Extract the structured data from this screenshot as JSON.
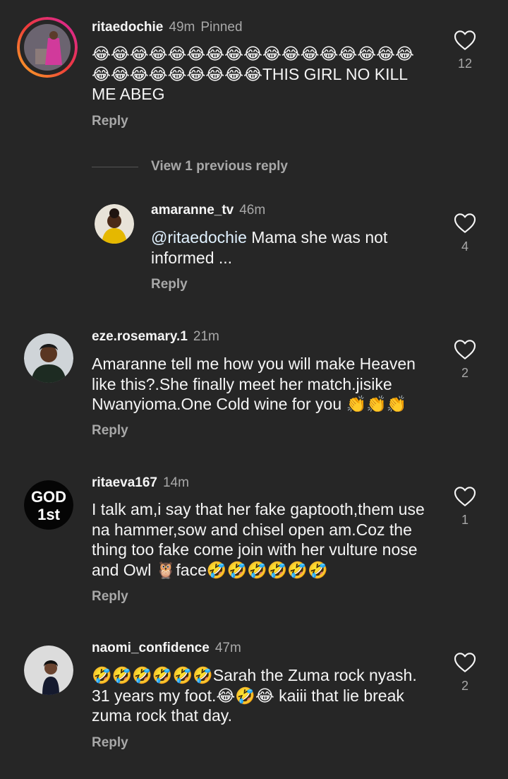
{
  "comments": [
    {
      "username": "ritaedochie",
      "time": "49m",
      "pinned": "Pinned",
      "text": "😂😂😂😂😂😂😂😂😂😂😂😂😂😂😂😂😂😂😂😂😂😂😂😂😂😂THIS GIRL NO KILL ME ABEG",
      "reply_label": "Reply",
      "likes": "12"
    },
    {
      "username": "eze.rosemary.1",
      "time": "21m",
      "text": "Amaranne tell me how you will make Heaven like this?.She finally meet her match.jisike Nwanyioma.One Cold wine for you 👏👏👏",
      "reply_label": "Reply",
      "likes": "2"
    },
    {
      "username": "ritaeva167",
      "time": "14m",
      "avatar_text_line1": "GOD",
      "avatar_text_line2": "1st",
      "text": "I talk am,i say that her fake gaptooth,them use na hammer,sow and chisel open am.Coz the thing too fake come join with her vulture nose and Owl 🦉face🤣🤣🤣🤣🤣🤣",
      "reply_label": "Reply",
      "likes": "1"
    },
    {
      "username": "naomi_confidence",
      "time": "47m",
      "text": "🤣🤣🤣🤣🤣🤣Sarah the Zuma rock nyash. 31 years my foot.😂🤣😂 kaiii that lie break zuma rock that day.",
      "reply_label": "Reply",
      "likes": "2"
    }
  ],
  "view_previous": "View 1 previous reply",
  "reply": {
    "username": "amaranne_tv",
    "time": "46m",
    "mention": "@ritaedochie",
    "text": " Mama she was not informed ...",
    "reply_label": "Reply",
    "likes": "4"
  },
  "colors": {
    "background": "#262626",
    "secondary_text": "#a8a8a8",
    "story_ring_start": "#f9a825",
    "story_ring_end": "#d6249f"
  },
  "icons": {
    "like": "heart-outline-icon"
  }
}
